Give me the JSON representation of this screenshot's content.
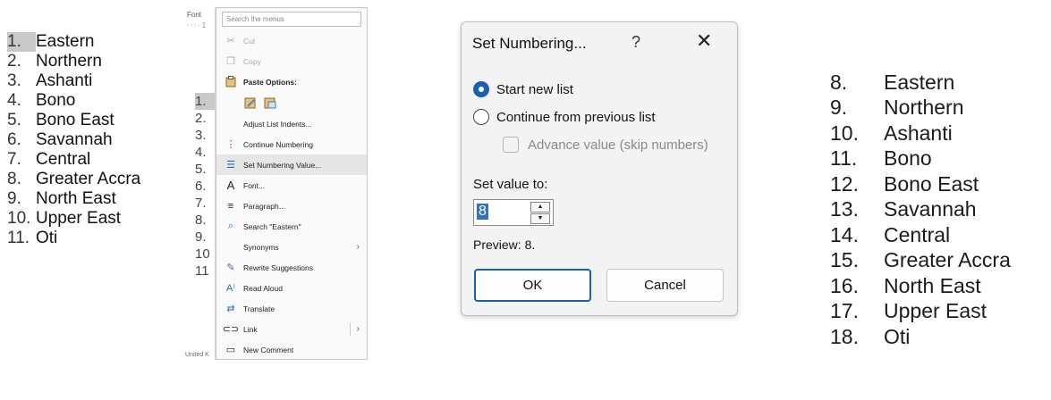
{
  "left_list": {
    "items": [
      {
        "num": "1.",
        "text": "Eastern",
        "selected": true
      },
      {
        "num": "2.",
        "text": "Northern"
      },
      {
        "num": "3.",
        "text": "Ashanti"
      },
      {
        "num": "4.",
        "text": "Bono"
      },
      {
        "num": "5.",
        "text": "Bono East"
      },
      {
        "num": "6.",
        "text": "Savannah"
      },
      {
        "num": "7.",
        "text": "Central"
      },
      {
        "num": "8.",
        "text": "Greater Accra"
      },
      {
        "num": "9.",
        "text": "North East"
      },
      {
        "num": "10.",
        "text": "Upper East"
      },
      {
        "num": "11.",
        "text": "Oti"
      }
    ]
  },
  "menu_region": {
    "doc_top_text": "Font",
    "doc_top_text2": "· ◌ · 1",
    "doc_numbers": [
      "1.",
      "2.",
      "3.",
      "4.",
      "5.",
      "6.",
      "7.",
      "8.",
      "9.",
      "10",
      "11"
    ],
    "doc_bottom_text": "United K",
    "search_placeholder": "Search the menus",
    "items": {
      "cut": "Cut",
      "copy": "Copy",
      "paste_options": "Paste Options:",
      "adjust_indents": "Adjust List Indents...",
      "continue_numbering": "Continue Numbering",
      "set_numbering_value": "Set Numbering Value...",
      "font": "Font...",
      "paragraph": "Paragraph...",
      "search": "Search \"Eastern\"",
      "synonyms": "Synonyms",
      "rewrite": "Rewrite Suggestions",
      "read_aloud": "Read Aloud",
      "translate": "Translate",
      "link": "Link",
      "new_comment": "New Comment"
    }
  },
  "dialog": {
    "title": "Set Numbering...",
    "help": "?",
    "close": "✕",
    "start_new": "Start new list",
    "continue_prev": "Continue from previous list",
    "advance": "Advance value (skip numbers)",
    "set_value_label": "Set value to:",
    "value": "8",
    "preview": "Preview: 8.",
    "ok": "OK",
    "cancel": "Cancel",
    "accent": "#1a5fb4"
  },
  "right_list": {
    "items": [
      {
        "num": "8.",
        "text": "Eastern"
      },
      {
        "num": "9.",
        "text": "Northern"
      },
      {
        "num": "10.",
        "text": "Ashanti"
      },
      {
        "num": "11.",
        "text": "Bono"
      },
      {
        "num": "12.",
        "text": "Bono East"
      },
      {
        "num": "13.",
        "text": "Savannah"
      },
      {
        "num": "14.",
        "text": "Central"
      },
      {
        "num": "15.",
        "text": "Greater Accra"
      },
      {
        "num": "16.",
        "text": "North East"
      },
      {
        "num": "17.",
        "text": "Upper East"
      },
      {
        "num": "18.",
        "text": "Oti"
      }
    ]
  }
}
